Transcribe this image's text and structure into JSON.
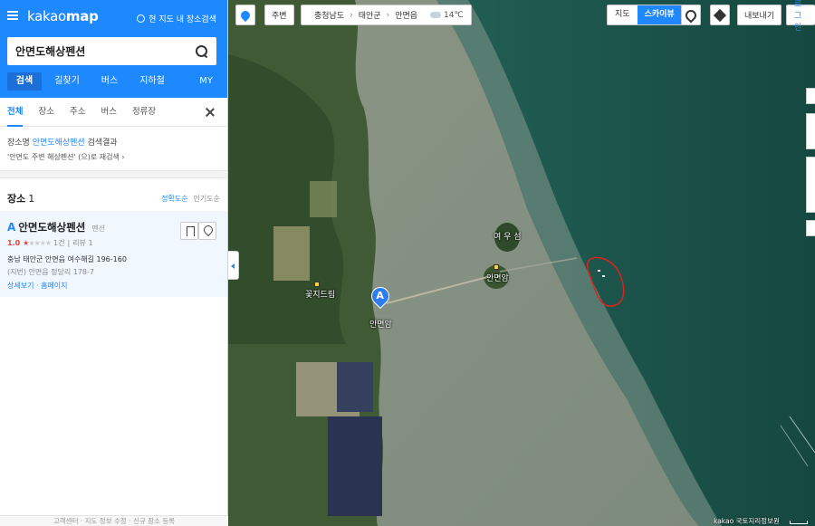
{
  "panel": {
    "logo_prefix": "kakao",
    "logo_suffix": "map",
    "map_search_toggle": "현 지도 내 장소검색",
    "search_query": "안면도해상펜션",
    "nav_tabs": [
      "검색",
      "길찾기",
      "버스",
      "지하철",
      "MY"
    ],
    "sub_tabs": [
      "전체",
      "장소",
      "주소",
      "버스",
      "정류장"
    ],
    "result_prefix": "장소명",
    "result_keyword": "안면도해상펜션",
    "result_suffix": "검색결과",
    "result_hint": "'안면도 주변 해상펜션' (으)로 재검색 ›",
    "places_title": "장소",
    "places_count": "1",
    "sort_accuracy": "정확도순",
    "sort_popular": "인기도순",
    "place": {
      "letter": "A",
      "name": "안면도해상펜션",
      "category": "펜션",
      "score": "1.0",
      "review_count": "1건",
      "review_label": "리뷰 1",
      "address": "충남 태안군 안면읍 여수해길 196-160",
      "address_lot": "(지번) 안면읍 정당리 178-7",
      "links": "상세보기 · 홈페이지"
    },
    "footer": "고객센터 · 지도 정보 수정 · 신규 장소 등록"
  },
  "map": {
    "around_label": "주변",
    "breadcrumbs": [
      "충청남도",
      "태안군",
      "안면읍"
    ],
    "weather": "14℃",
    "maptype": [
      "지도",
      "스카이뷰"
    ],
    "share_label": "내보내기",
    "login_label": "로그인",
    "labels": {
      "island": "여 우 섬",
      "port": "안면암",
      "temple": "안면암",
      "place": "꽃지드림",
      "marker": "A"
    },
    "copyright": "kakao 국토지리정보원"
  },
  "colors": {
    "accent": "#1e88ff",
    "sea": "#1f5a50",
    "mudflat": "#8d9a86"
  }
}
